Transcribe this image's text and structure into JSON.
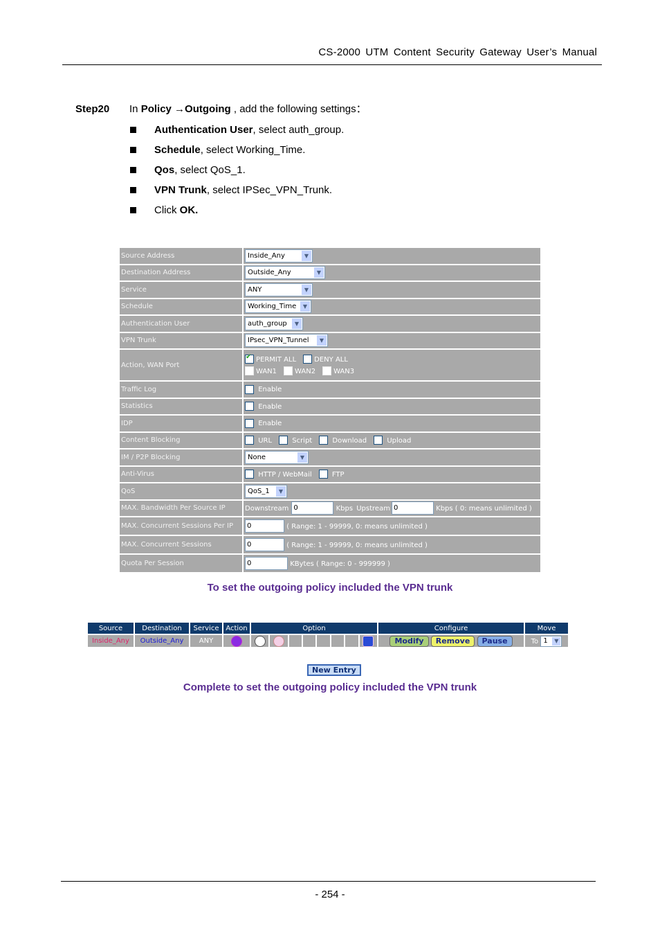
{
  "header": {
    "title": "CS-2000 UTM Content Security Gateway User’s Manual"
  },
  "step": {
    "label": "Step20",
    "intro_prefix": "In ",
    "intro_bold": "Policy →Outgoing",
    "intro_suffix": " , add the following settings：",
    "bullets": [
      {
        "bold": "Authentication User",
        "text": ", select auth_group."
      },
      {
        "bold": "Schedule",
        "text": ", select Working_Time."
      },
      {
        "bold": "Qos",
        "text": ", select QoS_1."
      },
      {
        "bold": "VPN Trunk",
        "text": ", select IPSec_VPN_Trunk."
      },
      {
        "prefix": "Click ",
        "bold": "OK."
      }
    ]
  },
  "form": {
    "source_address": {
      "label": "Source Address",
      "value": "Inside_Any"
    },
    "destination_address": {
      "label": "Destination Address",
      "value": "Outside_Any"
    },
    "service": {
      "label": "Service",
      "value": "ANY"
    },
    "schedule": {
      "label": "Schedule",
      "value": "Working_Time"
    },
    "auth_user": {
      "label": "Authentication User",
      "value": "auth_group"
    },
    "vpn_trunk": {
      "label": "VPN Trunk",
      "value": "IPsec_VPN_Tunnel"
    },
    "action": {
      "label": "Action, WAN Port",
      "permit": "PERMIT ALL",
      "permit_checked": true,
      "deny": "DENY ALL",
      "wan1": "WAN1",
      "wan2": "WAN2",
      "wan3": "WAN3"
    },
    "traffic_log": {
      "label": "Traffic Log",
      "option": "Enable"
    },
    "statistics": {
      "label": "Statistics",
      "option": "Enable"
    },
    "idp": {
      "label": "IDP",
      "option": "Enable"
    },
    "content_blocking": {
      "label": "Content Blocking",
      "url": "URL",
      "script": "Script",
      "download": "Download",
      "upload": "Upload"
    },
    "im_p2p": {
      "label": "IM / P2P Blocking",
      "value": "None"
    },
    "anti_virus": {
      "label": "Anti-Virus",
      "http": "HTTP / WebMail",
      "ftp": "FTP"
    },
    "qos": {
      "label": "QoS",
      "value": "QoS_1"
    },
    "bandwidth": {
      "label": "MAX. Bandwidth Per Source IP",
      "downstream_label": "Downstream",
      "downstream": "0",
      "kbps": "Kbps",
      "upstream_label": "Upstream",
      "upstream": "0",
      "note": "Kbps ( 0: means unlimited )"
    },
    "sessions_per_ip": {
      "label": "MAX. Concurrent Sessions Per IP",
      "value": "0",
      "note": "( Range: 1 - 99999, 0: means unlimited )"
    },
    "sessions": {
      "label": "MAX. Concurrent Sessions",
      "value": "0",
      "note": "( Range: 1 - 99999, 0: means unlimited )"
    },
    "quota": {
      "label": "Quota Per Session",
      "value": "0",
      "note": "KBytes  ( Range: 0 - 999999 )"
    }
  },
  "caption1": "To set the outgoing policy included the VPN trunk",
  "policy_table": {
    "headers": [
      "Source",
      "Destination",
      "Service",
      "Action",
      "Option",
      "Configure",
      "Move"
    ],
    "row": {
      "source": "Inside_Any",
      "destination": "Outside_Any",
      "service": "ANY",
      "action_icon": "vpn-icon",
      "option_icons": [
        "schedule-clock-icon",
        "auth-user-key-icon",
        "vpn-trunk-icon"
      ],
      "modify": "Modify",
      "remove": "Remove",
      "pause": "Pause",
      "move_to": "To",
      "move_value": "1"
    },
    "colors": {
      "header_bg": "#0f3a6b",
      "source": "#e0246b",
      "destination": "#1a1ad6"
    }
  },
  "new_entry": "New Entry",
  "caption2": "Complete to set the outgoing policy included the VPN trunk",
  "footer": {
    "page": "- 254 -"
  }
}
